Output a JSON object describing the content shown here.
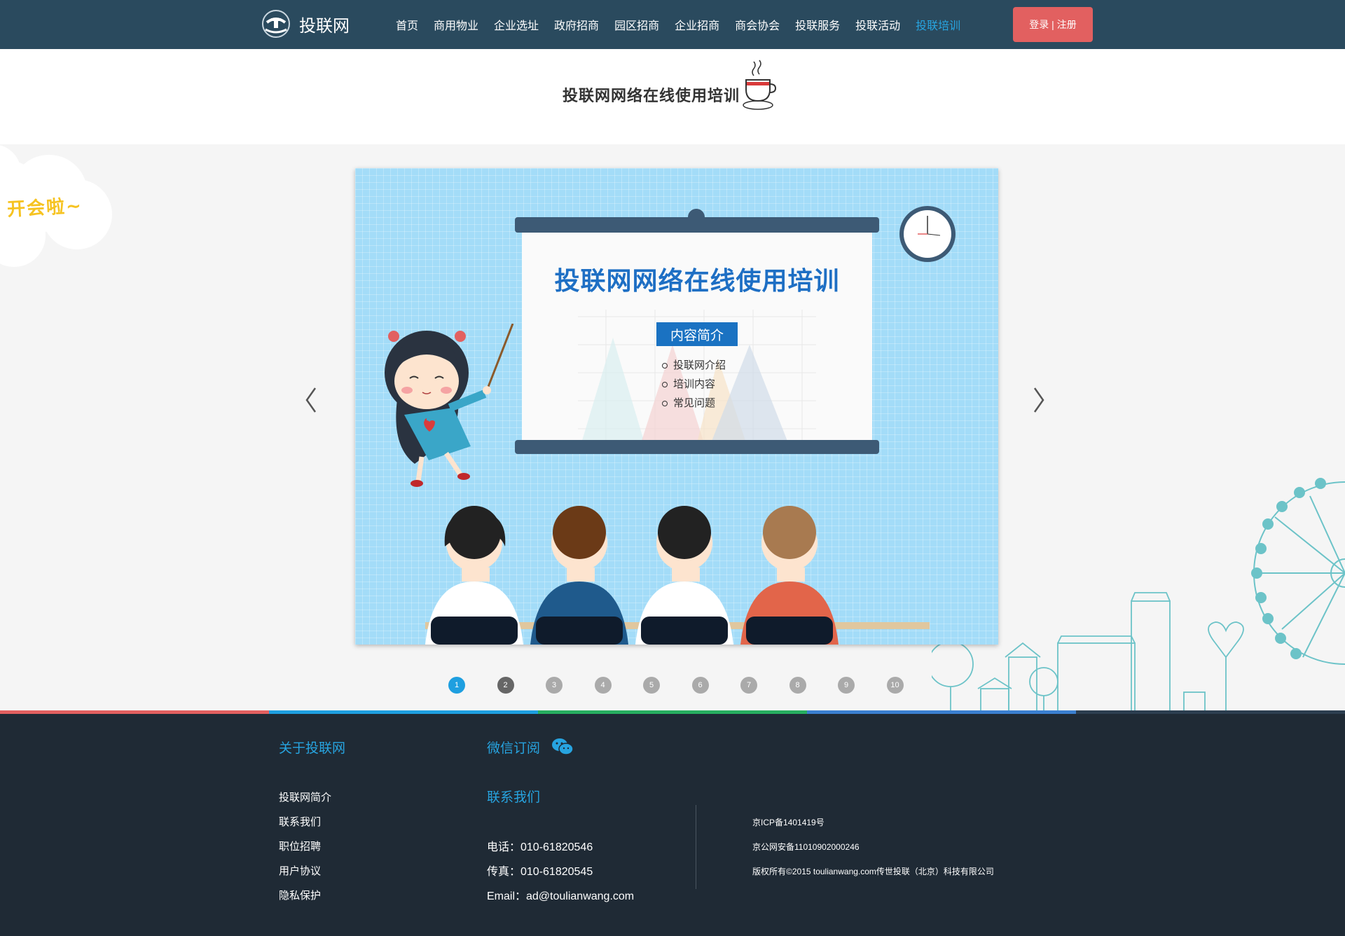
{
  "header": {
    "logo_text": "投联网",
    "nav": [
      "首页",
      "商用物业",
      "企业选址",
      "政府招商",
      "园区招商",
      "企业招商",
      "商会协会",
      "投联服务",
      "投联活动",
      "投联培训"
    ],
    "active_index": 9,
    "login_label": "登录 | 注册"
  },
  "title": "投联网网络在线使用培训",
  "decor": {
    "cloud_text": "开会啦~"
  },
  "slide": {
    "heading": "投联网网络在线使用培训",
    "chip": "内容简介",
    "items": [
      "投联网介绍",
      "培训内容",
      "常见问题"
    ]
  },
  "pagination": {
    "labels": [
      "1",
      "2",
      "3",
      "4",
      "5",
      "6",
      "7",
      "8",
      "9",
      "10"
    ],
    "active": 1
  },
  "footer": {
    "about_title": "关于投联网",
    "about_links": [
      "投联网简介",
      "联系我们",
      "职位招聘",
      "用户协议",
      "隐私保护"
    ],
    "wechat_title": "微信订阅",
    "contact_title": "联系我们",
    "phone": "电话：010-61820546",
    "fax": "传真：010-61820545",
    "email": "Email：ad@toulianwang.com",
    "icp": "京ICP备1401419号",
    "police": "京公网安备11010902000246",
    "copyright": "版权所有©2015 toulianwang.com传世投联（北京）科技有限公司"
  },
  "colors": {
    "header_bg": "#2a4a5e",
    "accent": "#27a4e0",
    "login_bg": "#e26060",
    "footer_bg": "#1f2a35",
    "strip": [
      "#e26060",
      "#1e9fe0",
      "#27ae60",
      "#3b7fd0",
      "#2c3e50"
    ]
  }
}
